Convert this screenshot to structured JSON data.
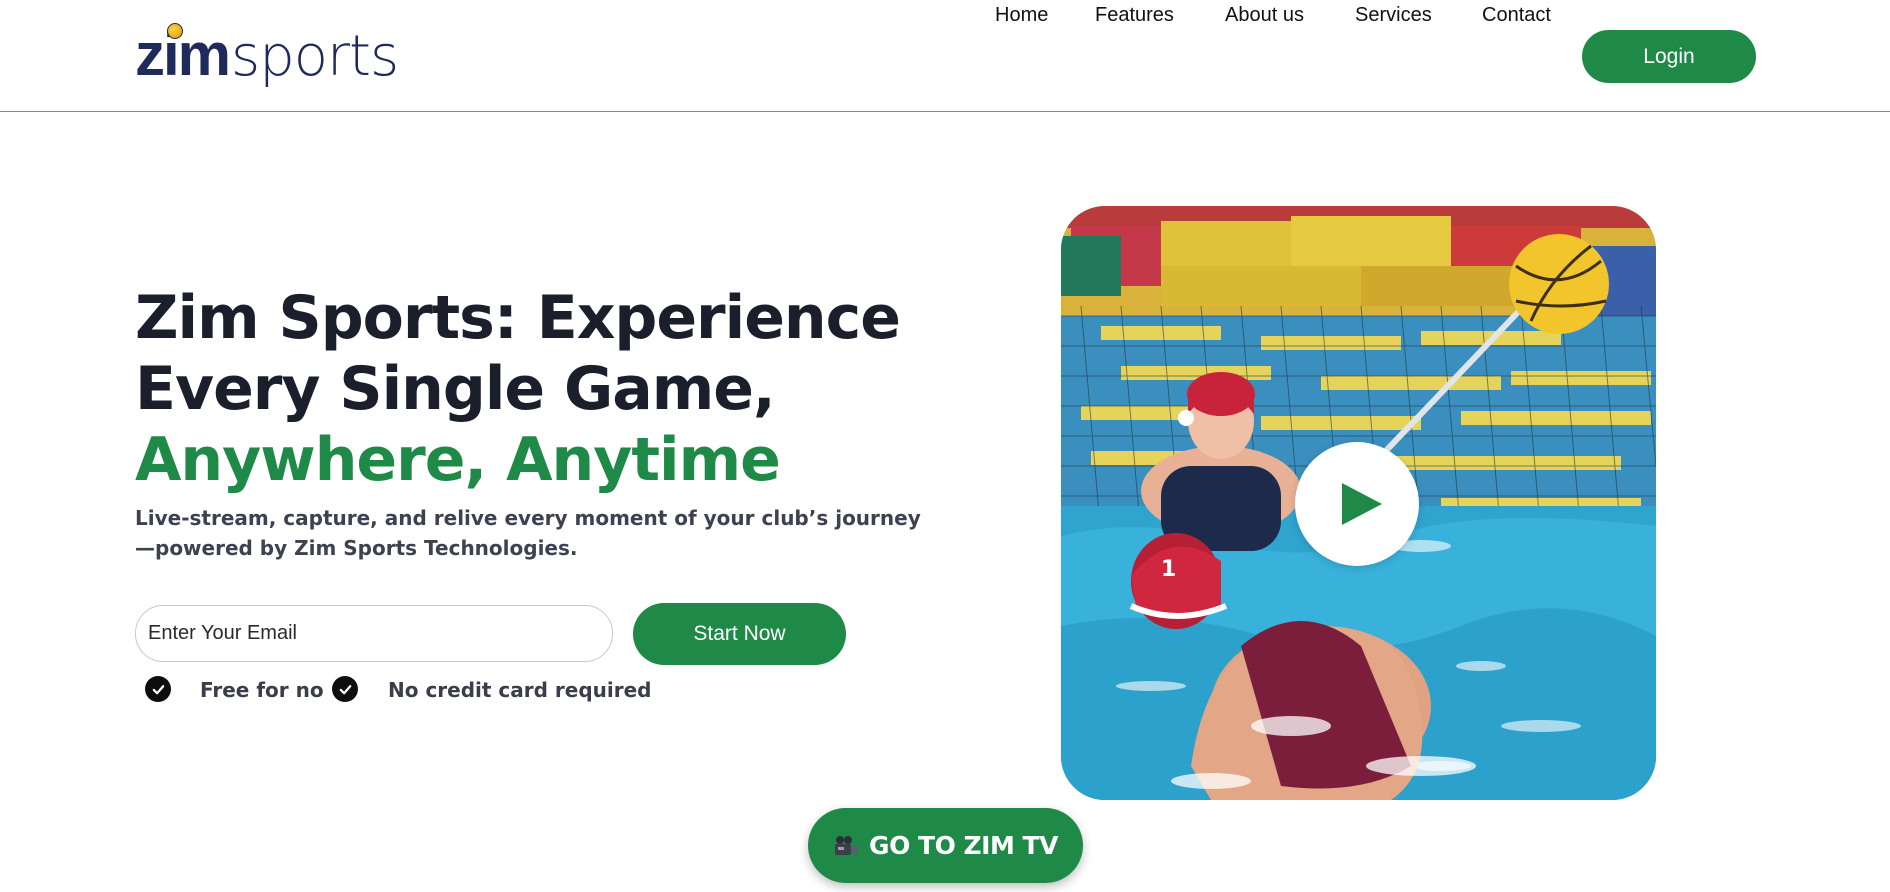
{
  "brand": {
    "logo_primary": "zim",
    "logo_secondary": "sports",
    "color_navy": "#1f2a5c",
    "color_accent": "#1f8a47"
  },
  "nav": {
    "items": [
      "Home",
      "Features",
      "About us",
      "Services",
      "Contact"
    ],
    "login_label": "Login"
  },
  "hero": {
    "title_line1": "Zim Sports: Experience",
    "title_line2": "Every Single Game,",
    "title_accent": "Anywhere, Anytime",
    "subtitle": "Live-stream, capture, and relive every moment of your club’s journey—powered by Zim Sports Technologies.",
    "email_placeholder": "Enter Your Email",
    "cta_label": "Start Now",
    "checks": [
      "Free for no",
      "No credit card required"
    ]
  },
  "video": {
    "icons": [
      "play-icon"
    ]
  },
  "zimtv": {
    "label": "GO TO ZIM TV",
    "icon": "movie-camera-icon"
  }
}
